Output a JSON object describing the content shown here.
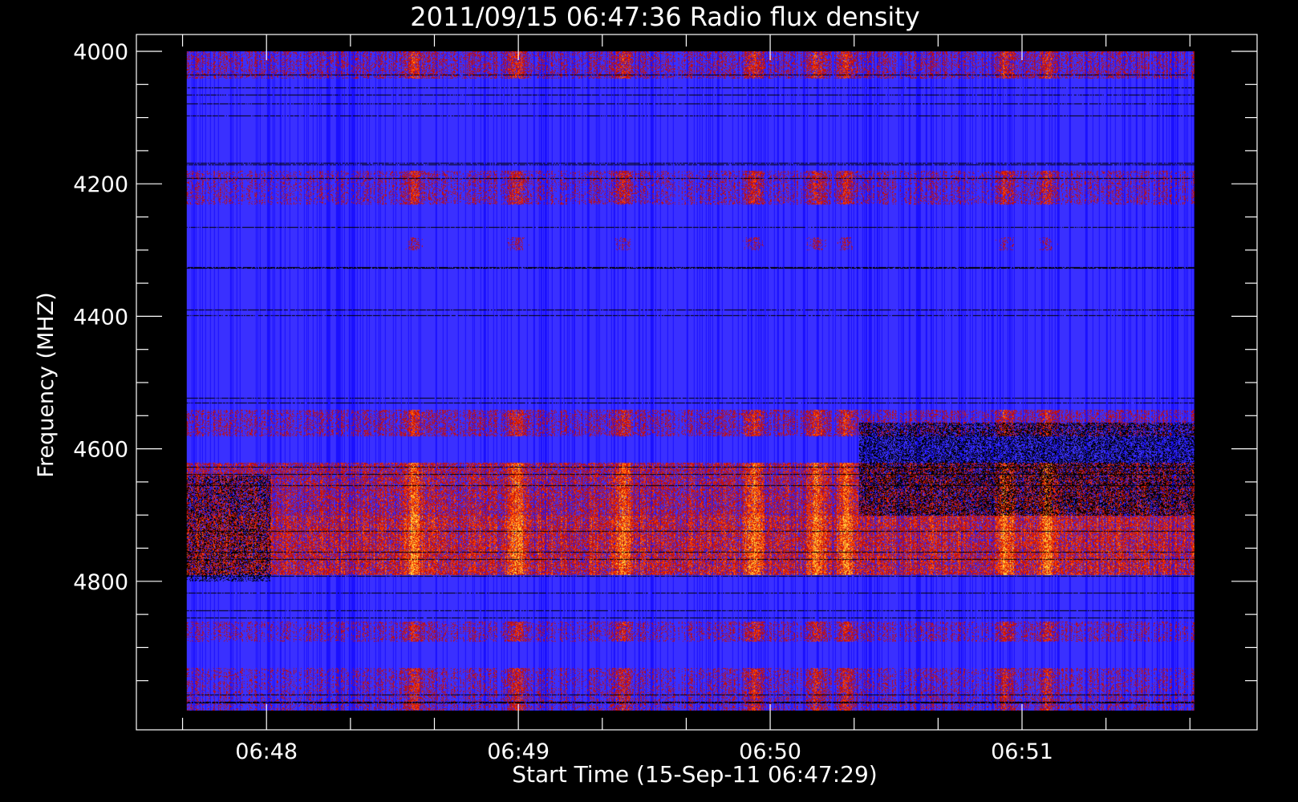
{
  "chart_data": {
    "type": "heatmap",
    "title": "2011/09/15 06:47:36 Radio flux density",
    "xlabel": "Start Time (15-Sep-11 06:47:29)",
    "ylabel": "Frequency (MHZ)",
    "y_axis": {
      "range": [
        4000,
        5000
      ],
      "ticks": [
        4000,
        4200,
        4400,
        4600,
        4800
      ],
      "tick_labels": [
        "4000",
        "4200",
        "4400",
        "4600",
        "4800"
      ],
      "minor_step": 50,
      "inverted": true
    },
    "x_axis": {
      "range": [
        "06:47:29",
        "06:51:56"
      ],
      "ticks": [
        "06:48:00",
        "06:49:00",
        "06:50:00",
        "06:51:00"
      ],
      "tick_labels": [
        "06:48",
        "06:49",
        "06:50",
        "06:51"
      ],
      "minor_step_seconds": 20
    },
    "data_extent": {
      "time_start": "06:47:41",
      "time_end": "06:51:41",
      "freq_start": 4000,
      "freq_end": 4995
    },
    "colormap": [
      "#000000",
      "#1a10ff",
      "#3a30ff",
      "#c01010",
      "#ff4000",
      "#ff9020",
      "#ffd040"
    ],
    "bursts_seconds": [
      54,
      79,
      104,
      135,
      150,
      157,
      195,
      205
    ],
    "frequency_bands": [
      {
        "from": 4000,
        "to": 4040,
        "level": 0.6
      },
      {
        "from": 4180,
        "to": 4230,
        "level": 0.55
      },
      {
        "from": 4280,
        "to": 4300,
        "level": 0.35
      },
      {
        "from": 4540,
        "to": 4580,
        "level": 0.6
      },
      {
        "from": 4620,
        "to": 4700,
        "level": 0.8
      },
      {
        "from": 4700,
        "to": 4790,
        "level": 0.95
      },
      {
        "from": 4860,
        "to": 4890,
        "level": 0.55
      },
      {
        "from": 4930,
        "to": 4995,
        "level": 0.55
      }
    ],
    "grid": false,
    "legend": "none"
  }
}
